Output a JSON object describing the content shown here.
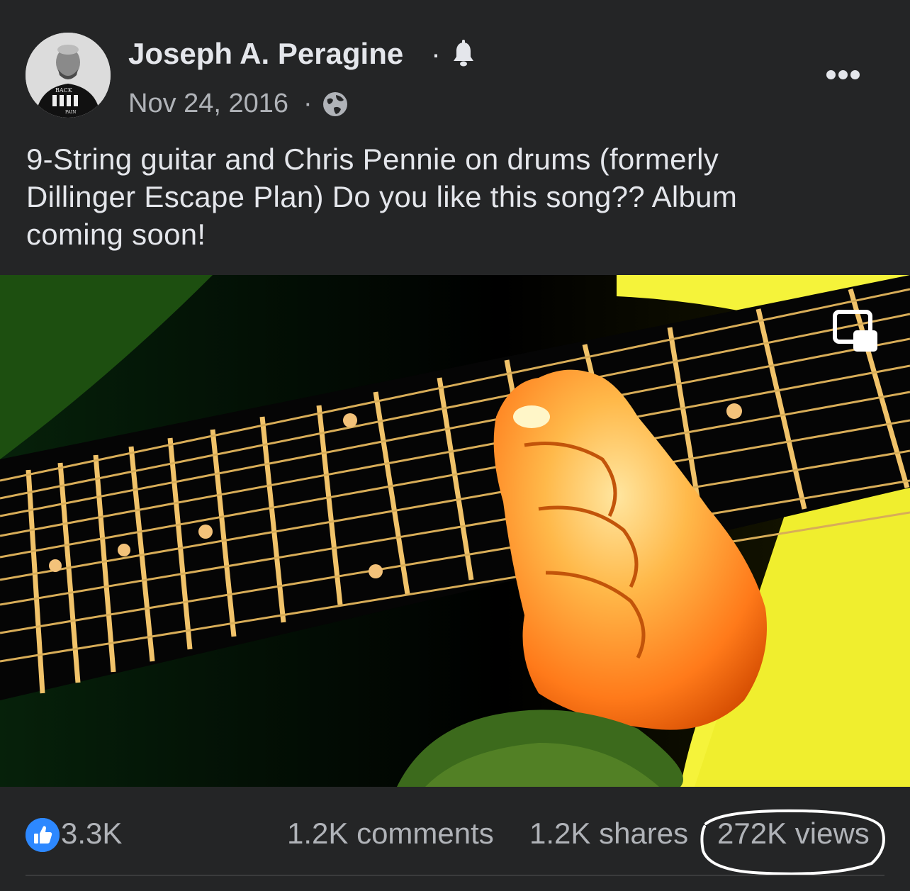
{
  "post": {
    "author": "Joseph A. Peragine",
    "name_separator": "·",
    "date": "Nov 24, 2016",
    "date_separator": "·",
    "caption": "9-String guitar and Chris Pennie on drums (formerly Dillinger Escape Plan) Do you like this song?? Album coming soon!",
    "avatar_shirt_text_top": "BACK",
    "avatar_shirt_text_bottom": "PAIN"
  },
  "icons": {
    "notification": "bell-icon",
    "privacy": "globe-icon",
    "menu": "more-options-icon",
    "video_control": "picture-in-picture-icon",
    "reaction": "like-thumbs-up-icon"
  },
  "stats": {
    "likes": "3.3K",
    "comments": "1.2K comments",
    "shares": "1.2K shares",
    "views": "272K views"
  },
  "colors": {
    "background": "#242526",
    "text_primary": "#e4e6eb",
    "text_secondary": "#b0b3b8",
    "like_blue": "#2d88ff"
  }
}
